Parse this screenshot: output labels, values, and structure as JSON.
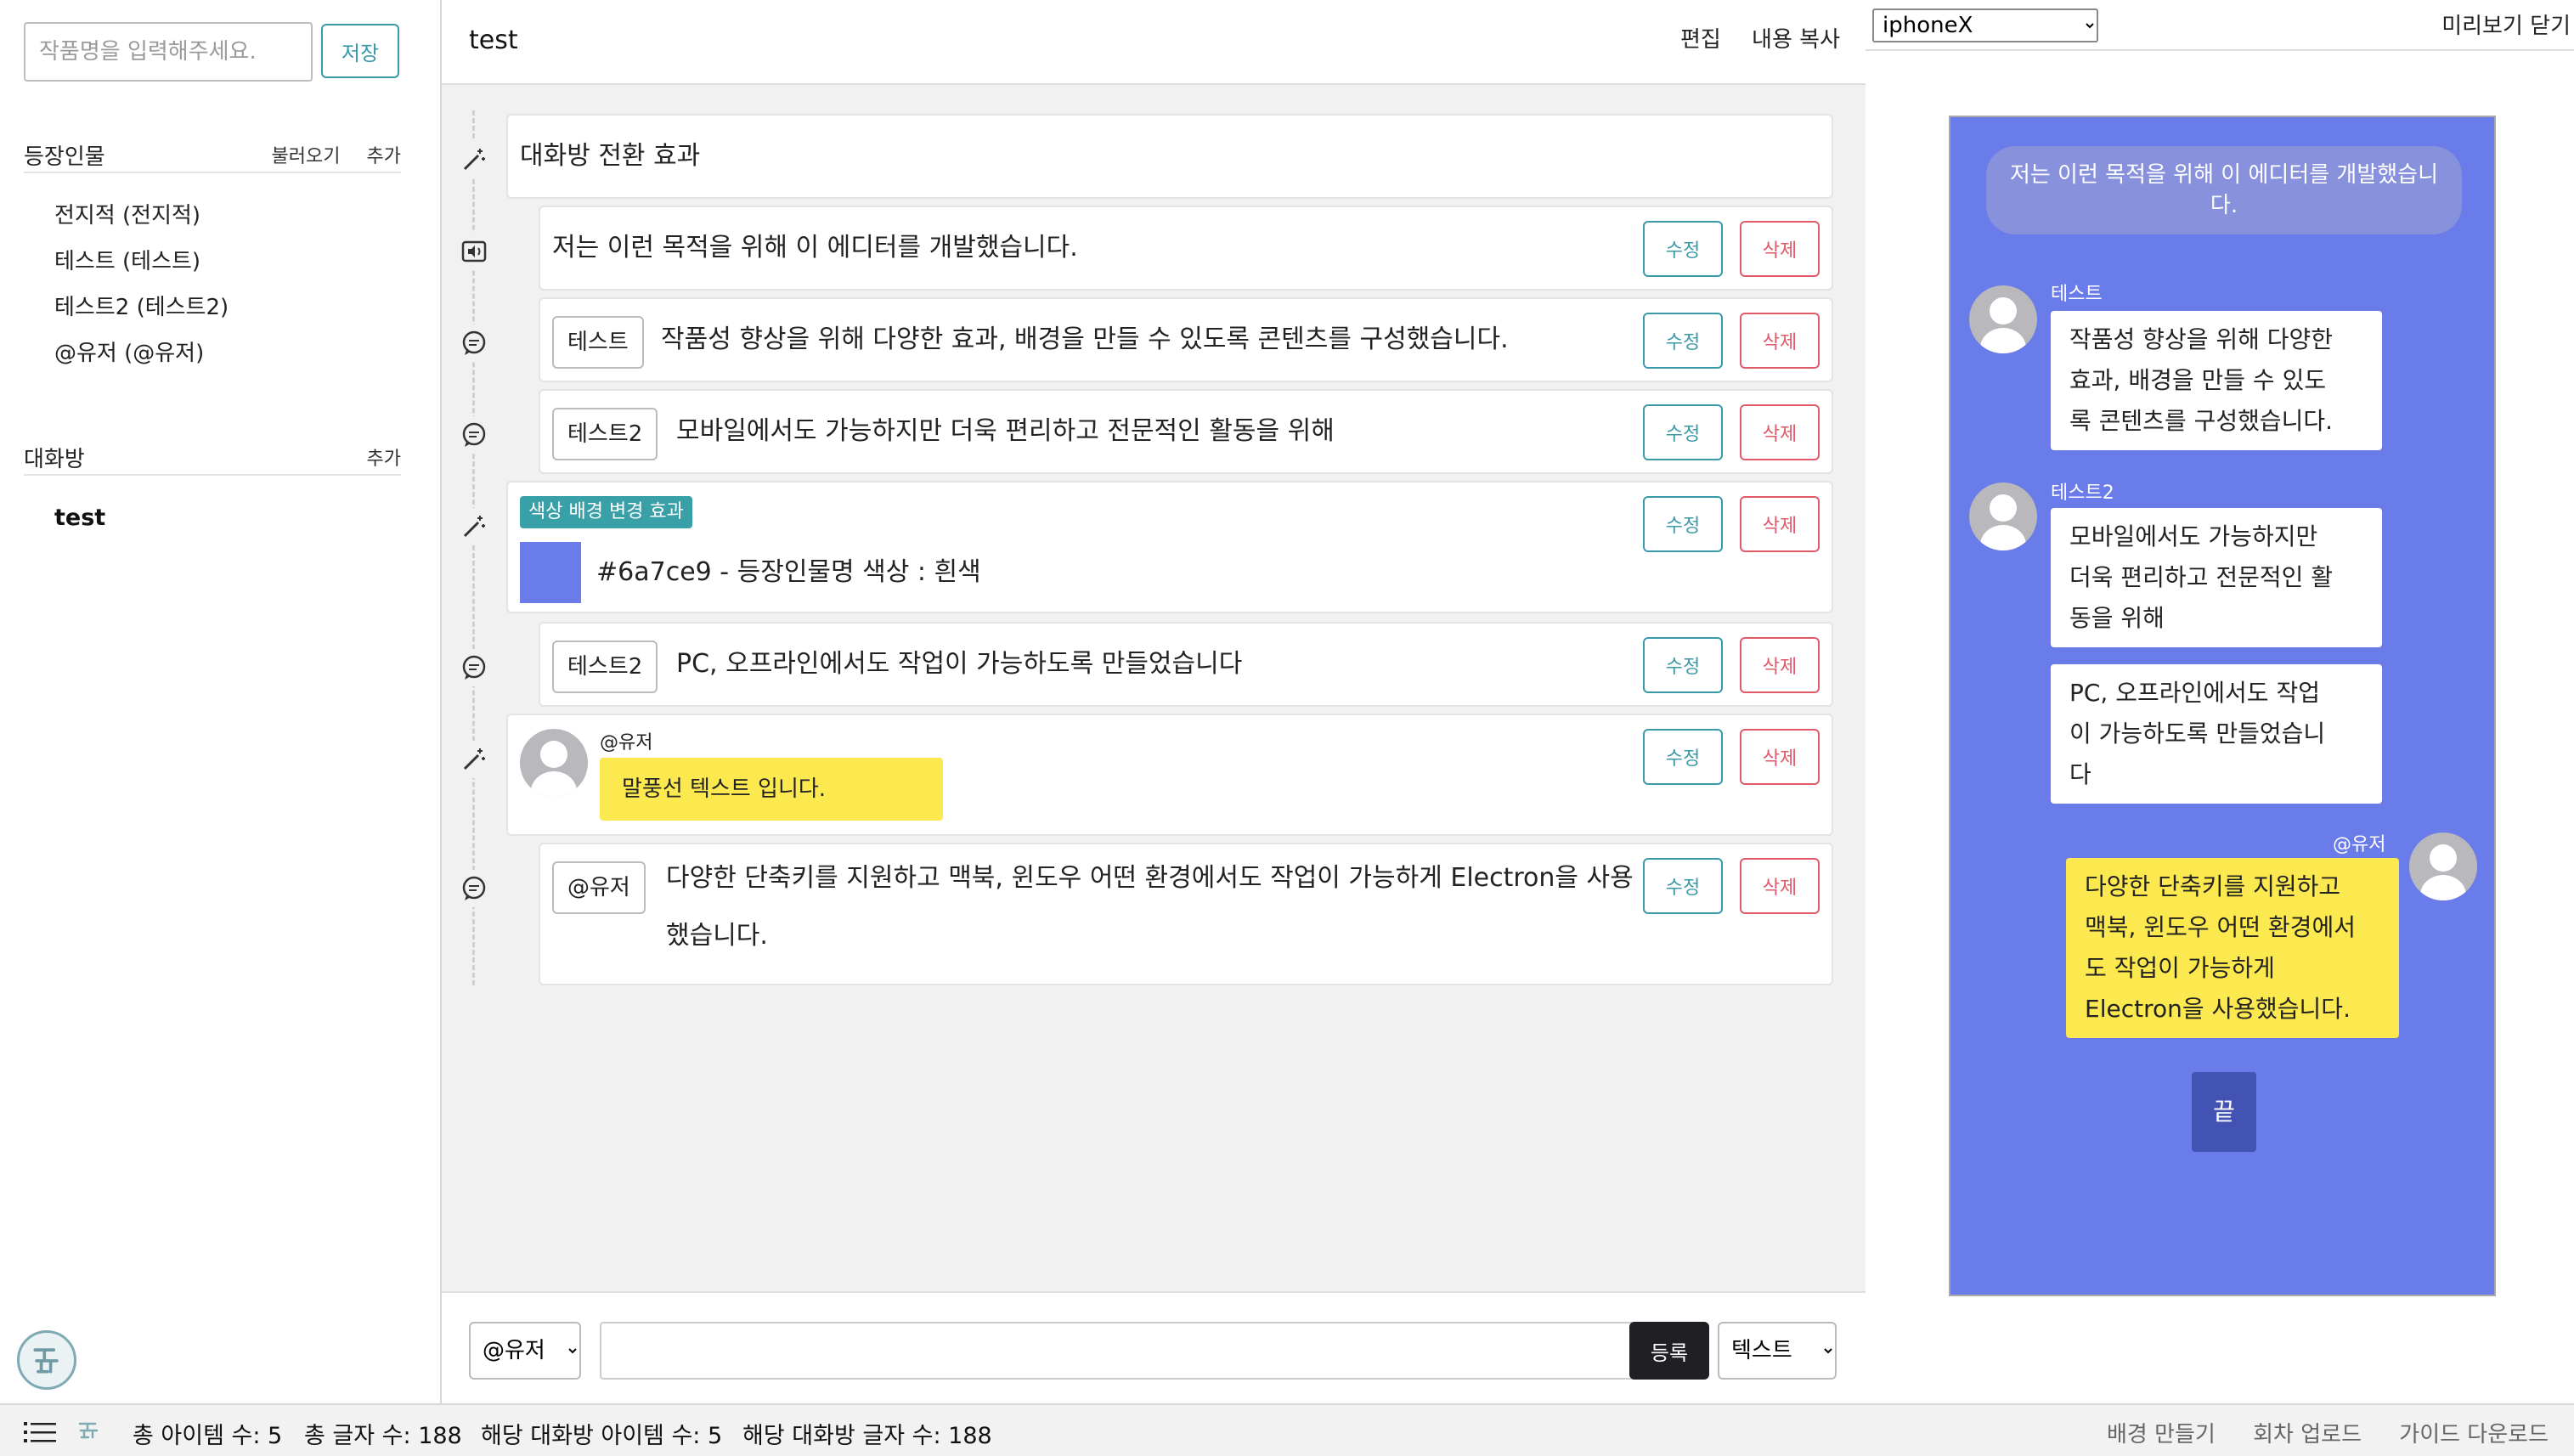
{
  "sidebar": {
    "title_placeholder": "작품명을 입력해주세요.",
    "save_label": "저장",
    "characters_label": "등장인물",
    "load_label": "불러오기",
    "add_label": "추가",
    "characters": [
      "전지적 (전지적)",
      "테스트 (테스트)",
      "테스트2 (테스트2)",
      "@유저 (@유저)"
    ],
    "rooms_label": "대화방",
    "rooms_add_label": "추가",
    "rooms": [
      "test"
    ]
  },
  "editor": {
    "title": "test",
    "edit_label": "편집",
    "copy_label": "내용 복사",
    "edit_btn": "수정",
    "delete_btn": "삭제",
    "items": {
      "effect1_text": "대화방 전환 효과",
      "narration_text": "저는 이런 목적을 위해 이 에디터를 개발했습니다.",
      "msg1_speaker": "테스트",
      "msg1_text": "작품성 향상을 위해 다양한 효과, 배경을 만들 수 있도록 콘텐츠를 구성했습니다.",
      "msg2_speaker": "테스트2",
      "msg2_text": "모바일에서도 가능하지만 더욱 편리하고 전문적인 활동을 위해",
      "effect2_badge": "색상 배경 변경 효과",
      "effect2_text": "#6a7ce9 - 등장인물명 색상 : 흰색",
      "effect2_color": "#6a7ce9",
      "msg3_speaker": "테스트2",
      "msg3_text": "PC, 오프라인에서도 작업이 가능하도록 만들었습니다",
      "effect3_name": "@유저",
      "effect3_bubble": "말풍선 텍스트 입니다.",
      "msg4_speaker": "@유저",
      "msg4_line1": "다양한 단축키를 지원하고 맥북, 윈도우 어떤 환경에서도 작업이 가능하게 Electron을 사용",
      "msg4_line2": "했습니다."
    },
    "compose": {
      "speaker_value": "@유저",
      "submit_label": "등록",
      "type_value": "텍스트"
    }
  },
  "preview": {
    "device": "iphoneX",
    "close_label": "미리보기 닫기",
    "bg_color": "#6a7ce9",
    "notice": "저는 이런 목적을 위해 이 에디터를 개발했습니다.",
    "name1": "테스트",
    "bubble1": [
      "작품성 향상을 위해 다양한",
      "효과, 배경을 만들 수 있도",
      "록 콘텐츠를 구성했습니다."
    ],
    "name2": "테스트2",
    "bubble2": [
      "모바일에서도 가능하지만",
      "더욱 편리하고 전문적인 활",
      "동을 위해"
    ],
    "bubble3": [
      "PC, 오프라인에서도 작업",
      "이 가능하도록 만들었습니",
      "다"
    ],
    "name3": "@유저",
    "bubble4": [
      "다양한 단축키를 지원하고",
      "맥북, 윈도우 어떤 환경에서",
      "도 작업이 가능하게",
      "Electron을 사용했습니다."
    ],
    "end_label": "끝"
  },
  "statusbar": {
    "total_items": "총 아이템 수: 5",
    "total_chars": "총 글자 수: 188",
    "room_items": "해당 대화방 아이템 수: 5",
    "room_chars": "해당 대화방 글자 수: 188",
    "links": [
      "배경 만들기",
      "회차 업로드",
      "가이드 다운로드"
    ]
  }
}
